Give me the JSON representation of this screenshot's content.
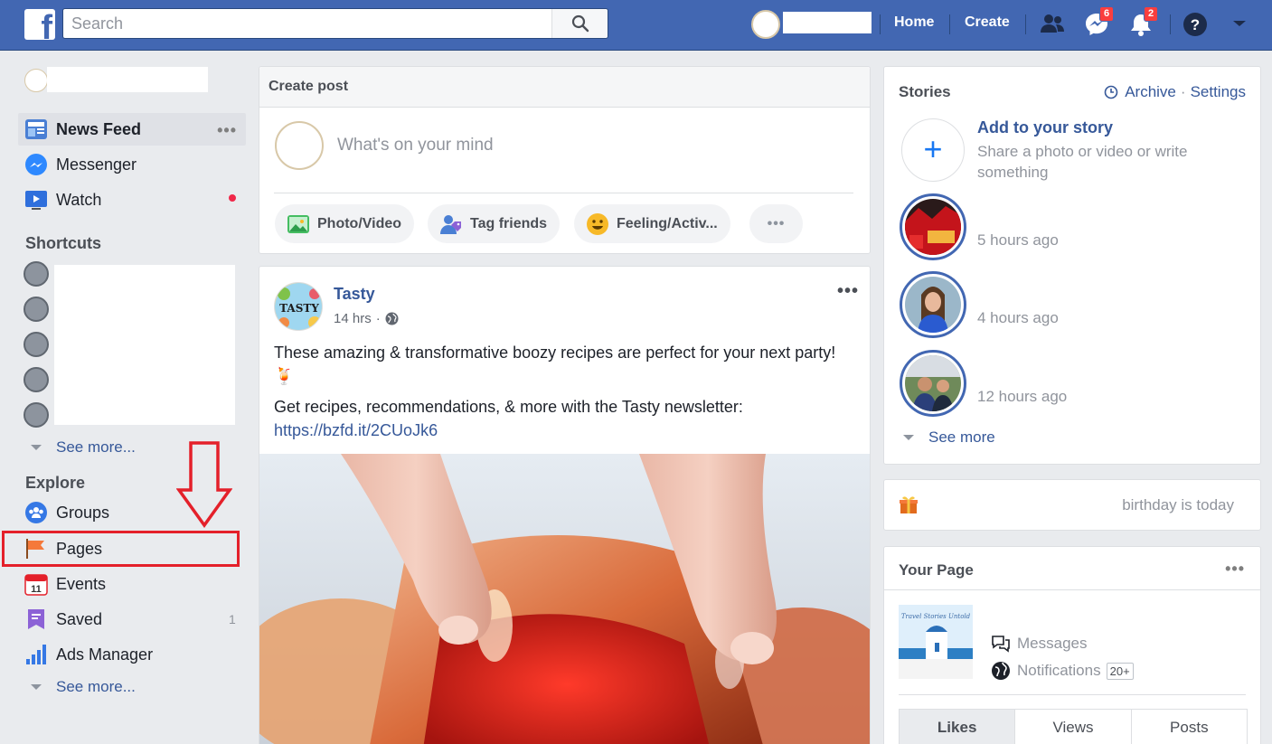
{
  "topbar": {
    "logo": "f",
    "search_placeholder": "Search",
    "home_label": "Home",
    "create_label": "Create",
    "messenger_badge": "6",
    "notifications_badge": "2"
  },
  "sidebar": {
    "main_items": [
      {
        "label": "News Feed",
        "icon": "news-feed-icon"
      },
      {
        "label": "Messenger",
        "icon": "messenger-icon"
      },
      {
        "label": "Watch",
        "icon": "watch-icon"
      }
    ],
    "more_dots": "•••",
    "shortcuts_title": "Shortcuts",
    "shortcuts_see_more": "See more...",
    "explore_title": "Explore",
    "explore_items": [
      {
        "label": "Groups",
        "icon": "groups-icon"
      },
      {
        "label": "Pages",
        "icon": "pages-flag-icon"
      },
      {
        "label": "Events",
        "icon": "events-calendar-icon",
        "icon_text": "11"
      },
      {
        "label": "Saved",
        "icon": "saved-icon",
        "count": "1"
      },
      {
        "label": "Ads Manager",
        "icon": "ads-manager-icon"
      }
    ],
    "explore_see_more": "See more..."
  },
  "create_post": {
    "header": "Create post",
    "placeholder": "What's on your mind",
    "actions": [
      {
        "label": "Photo/Video",
        "icon": "photo-video-icon"
      },
      {
        "label": "Tag friends",
        "icon": "tag-friends-icon"
      },
      {
        "label": "Feeling/Activ...",
        "icon": "feeling-emoji-icon"
      }
    ],
    "more": "•••"
  },
  "post": {
    "author": "Tasty",
    "avatar_text": "TASTY",
    "time": "14 hrs",
    "time_separator": "·",
    "dots": "•••",
    "text_line1": "These amazing & transformative boozy recipes are perfect for your next party! 🍹",
    "text_line2": "Get recipes, recommendations, & more with the Tasty newsletter:",
    "link": "https://bzfd.it/2CUoJk6"
  },
  "stories": {
    "title": "Stories",
    "archive": "Archive",
    "separator": "·",
    "settings": "Settings",
    "add_title": "Add to your story",
    "add_plus": "+",
    "add_subtitle": "Share a photo or video or write something",
    "items": [
      {
        "time": "5 hours ago"
      },
      {
        "time": "4 hours ago"
      },
      {
        "time": "12 hours ago"
      }
    ],
    "see_more": "See more"
  },
  "birthday": {
    "text": "birthday is today"
  },
  "your_page": {
    "title": "Your Page",
    "dots": "•••",
    "thumb_text": "Travel Stories Untold",
    "messages": "Messages",
    "notifications": "Notifications",
    "notifications_badge": "20+",
    "tabs": [
      "Likes",
      "Views",
      "Posts"
    ]
  },
  "colors": {
    "brand_blue": "#4267b2",
    "link_blue": "#365899",
    "badge_red": "#fa3e3e",
    "highlight_red": "#e4202a"
  }
}
